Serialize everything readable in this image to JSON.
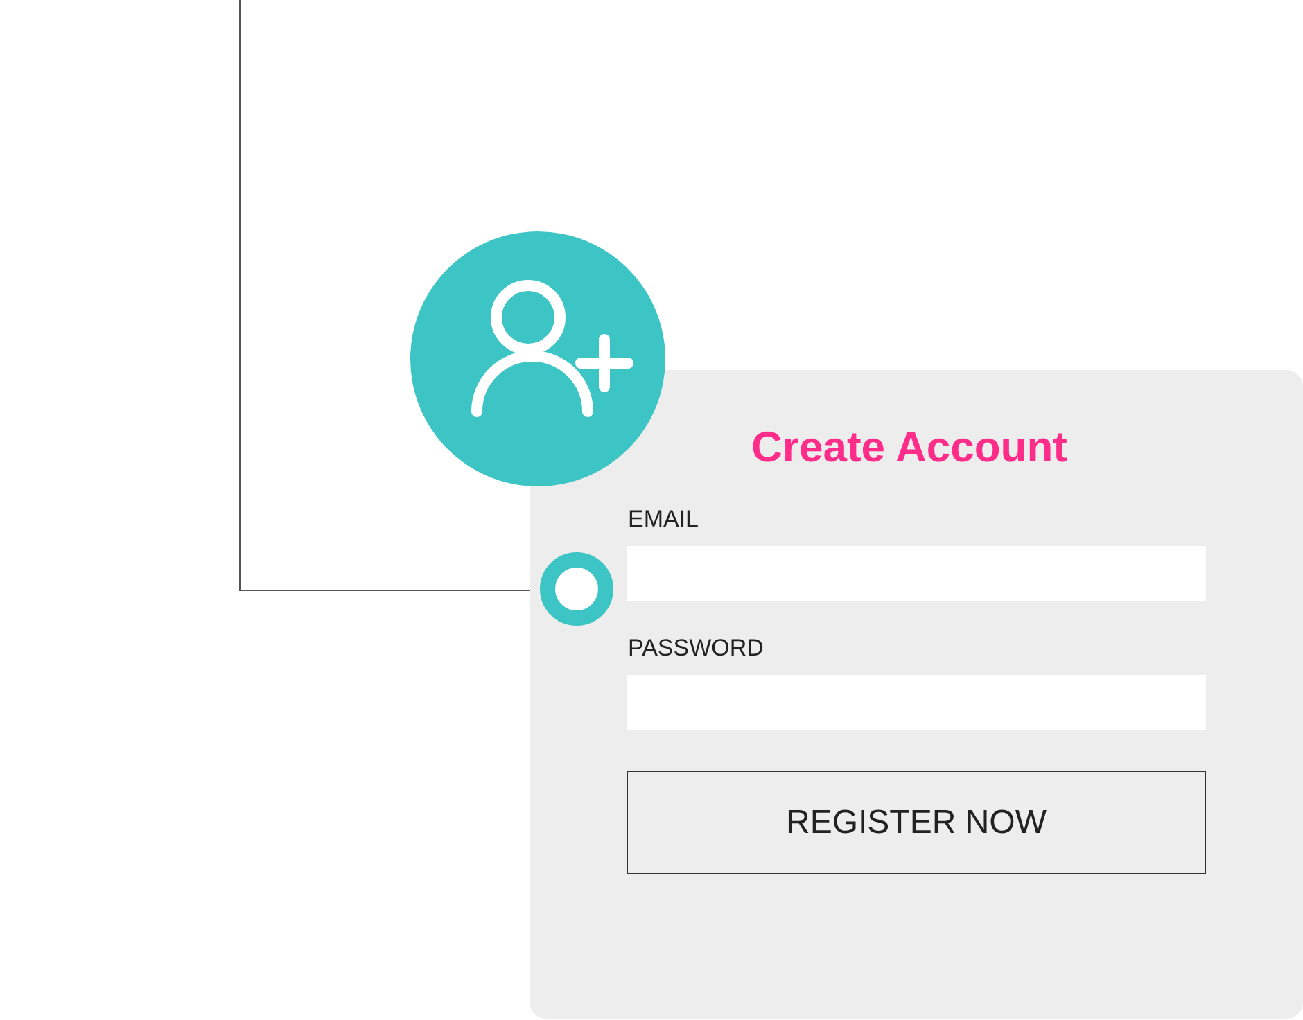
{
  "title": "Create Account",
  "fields": [
    {
      "label": "EMAIL"
    },
    {
      "label": "PASSWORD"
    }
  ],
  "button": "REGISTER NOW"
}
